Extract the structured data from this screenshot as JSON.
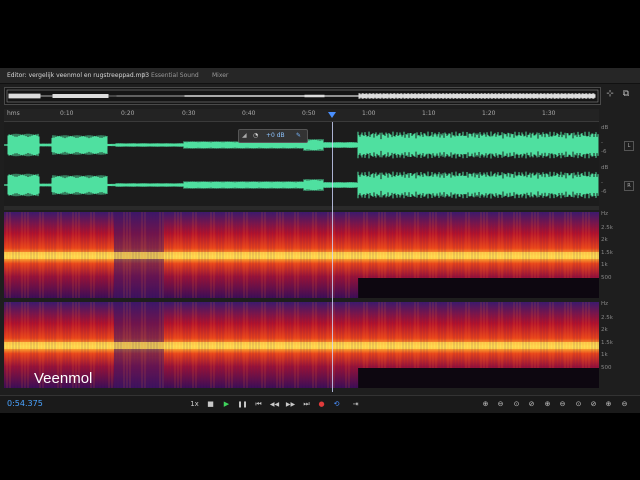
{
  "tabs": {
    "editor": "Editor: vergelijk veenmol en rugstreeppad.mp3",
    "menu_icon": "≡",
    "essential_sound": "Essential Sound",
    "mixer": "Mixer"
  },
  "ruler": {
    "unit": "hms",
    "ticks": [
      "0:10",
      "0:20",
      "0:30",
      "0:40",
      "0:50",
      "1:00",
      "1:10",
      "1:20",
      "1:30"
    ]
  },
  "hud": {
    "gain": "+0 dB"
  },
  "scale_db": {
    "top": [
      "dB",
      "-",
      "-6"
    ],
    "bottom": [
      "dB",
      "-",
      "-6"
    ]
  },
  "channels": {
    "left": "L",
    "right": "R"
  },
  "scale_hz": {
    "top": [
      "Hz",
      "2.5k",
      "2k",
      "1.5k",
      "1k",
      "500"
    ],
    "bottom": [
      "Hz",
      "2.5k",
      "2k",
      "1.5k",
      "1k",
      "500"
    ]
  },
  "overlay_label": "Veenmol",
  "status": {
    "time": "0:54.375",
    "speed": "1x"
  },
  "icons": {
    "stop": "■",
    "play": "▶",
    "pause": "❚❚",
    "to_start": "⏮",
    "rewind": "◀◀",
    "forward": "▶▶",
    "to_end": "⏭",
    "record": "●",
    "loop": "⟲",
    "zooms": [
      "⊕",
      "⊖",
      "⊙",
      "⊘",
      "⊕",
      "⊖",
      "⊙",
      "⊘",
      "⊕",
      "⊖",
      "⊙",
      "⊘"
    ]
  },
  "colors": {
    "waveform": "#4fe0a0",
    "accent": "#4a90ff",
    "record": "#e03b3b",
    "play": "#3fd35c"
  }
}
